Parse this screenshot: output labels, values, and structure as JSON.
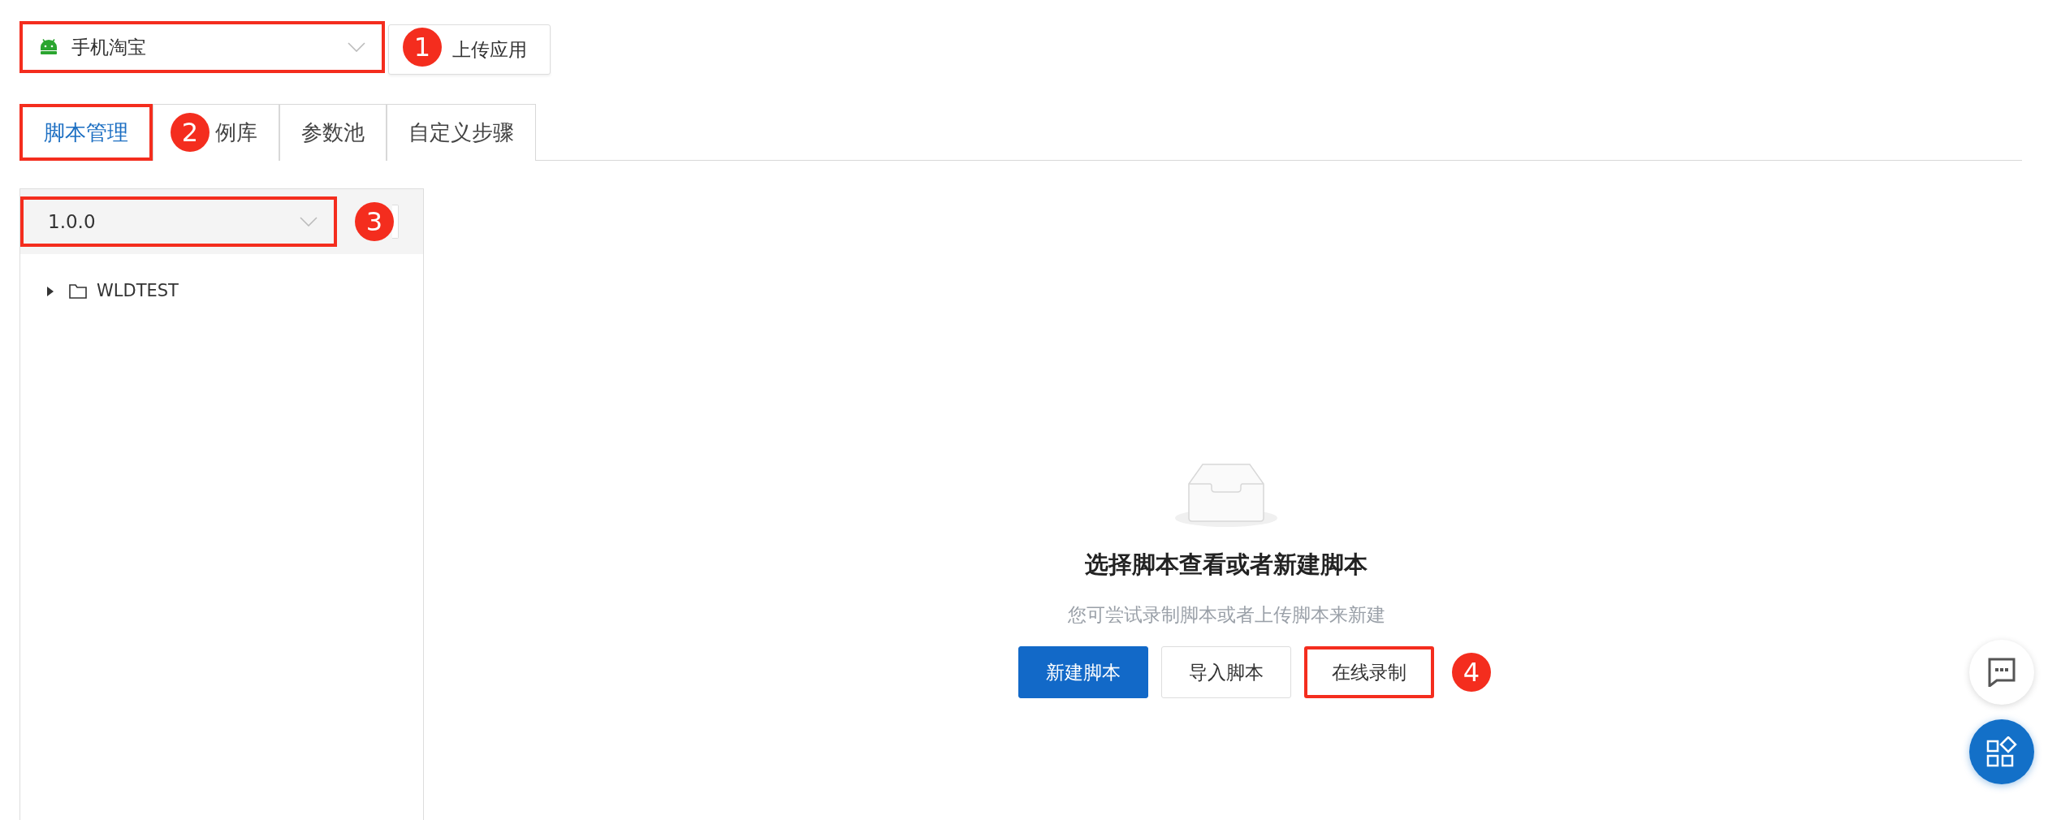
{
  "app_select": {
    "value": "手机淘宝",
    "highlighted": true,
    "callout": "1"
  },
  "upload_button": {
    "label": "上传应用"
  },
  "tabs": [
    {
      "label": "脚本管理",
      "selected": true,
      "highlighted": true,
      "callout": "2"
    },
    {
      "label": "例库",
      "selected": false
    },
    {
      "label": "参数池",
      "selected": false
    },
    {
      "label": "自定义步骤",
      "selected": false
    }
  ],
  "version_select": {
    "value": "1.0.0",
    "highlighted": true,
    "callout": "3"
  },
  "tree": [
    {
      "label": "WLDTEST",
      "expanded": false
    }
  ],
  "empty_state": {
    "title": "选择脚本查看或者新建脚本",
    "subtitle": "您可尝试录制脚本或者上传脚本来新建",
    "buttons": [
      {
        "label": "新建脚本",
        "kind": "primary",
        "highlighted": false
      },
      {
        "label": "导入脚本",
        "kind": "default",
        "highlighted": false
      },
      {
        "label": "在线录制",
        "kind": "default",
        "highlighted": true,
        "callout": "4"
      }
    ]
  }
}
